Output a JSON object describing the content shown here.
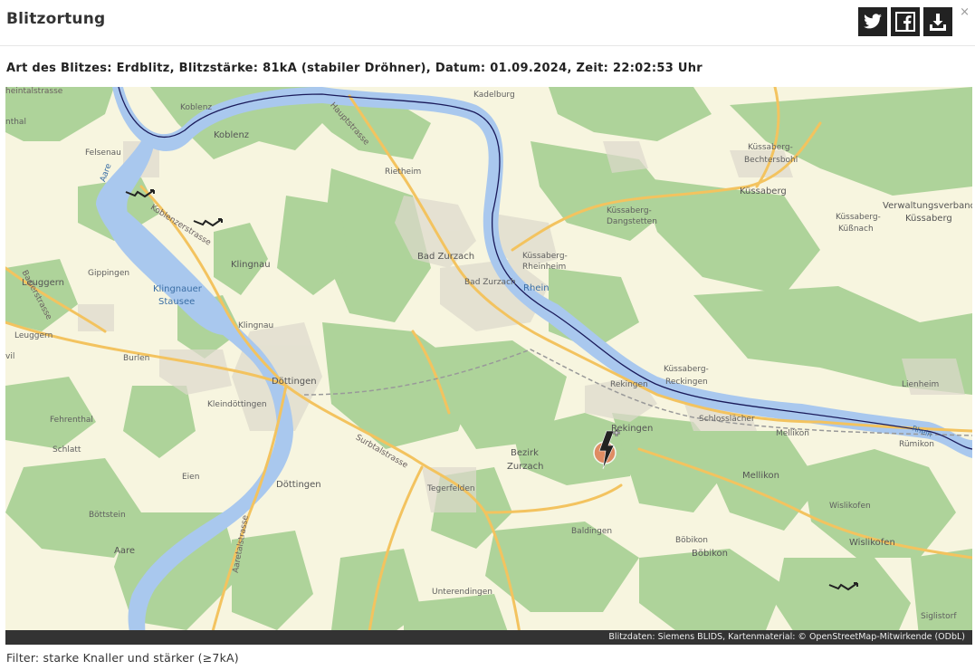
{
  "header": {
    "title": "Blitzortung",
    "share_twitter_icon": "twitter-icon",
    "share_facebook_icon": "facebook-icon",
    "download_icon": "download-icon",
    "close_label": "×"
  },
  "info": {
    "text": "Art des Blitzes: Erdblitz, Blitzstärke: 81kA (stabiler Dröhner), Datum: 01.09.2024, Zeit: 22:02:53 Uhr"
  },
  "map": {
    "labels": {
      "koblenz_top": "Koblenz",
      "koblenz": "Koblenz",
      "felsenau": "Felsenau",
      "aare_top": "Aare",
      "thal": "nthal",
      "heinstrasse": "heintalstrasse",
      "hauptstrasse": "Hauptstrasse",
      "kadelburg": "Kadelburg",
      "kuessaberg_top": "Küssaberg",
      "rietheim": "Rietheim",
      "koblenzerstrasse": "Koblenzerstrasse",
      "klingnau": "Klingnau",
      "gippingen": "Gippingen",
      "leuggern": "Leuggern",
      "leuggern2": "Leuggern",
      "baslerstrasse": "Baslerstrasse",
      "klingnauer": "Klingnauer",
      "stausee": "Stausee",
      "klingnau2": "Klingnau",
      "bad_zurzach": "Bad Zurzach",
      "bad_zurzach2": "Bad Zurzach",
      "rhein": "Rhein",
      "kuessaberg_rheinheim1": "Küssaberg-",
      "kuessaberg_rheinheim2": "Rheinheim",
      "kuessaberg_dang1": "Küssaberg-",
      "kuessaberg_dang2": "Dangstetten",
      "kuessaberg_bech1": "Küssaberg-",
      "kuessaberg_bech2": "Bechtersbohl",
      "kuessaberg": "Küssaberg",
      "verwaltungsverband1": "Verwaltungsverband",
      "verwaltungsverband2": "Küssaberg",
      "kuessaberg_kuess1": "Küssaberg-",
      "kuessaberg_kuess2": "Küßnach",
      "burlen": "Burlen",
      "doettingen": "Döttingen",
      "kleindoettingen": "Kleindöttingen",
      "fehrenthal": "Fehrenthal",
      "schlatt": "Schlatt",
      "vil": "vil",
      "rekingen_small": "Rekingen",
      "kuessaberg_rek1": "Küssaberg-",
      "kuessaberg_rek2": "Reckingen",
      "lienheim": "Lienheim",
      "schlosslaecher": "Schlosslächer",
      "rekingen": "Rekingen",
      "mellikon_small": "Mellikon",
      "ruemikon": "Rümikon",
      "rhein2": "Rhein",
      "surbtalstrasse": "Surbtalstrasse",
      "bezirk": "Bezirk",
      "zurzach": "Zurzach",
      "mellikon": "Mellikon",
      "eien": "Eien",
      "doettingen2": "Döttingen",
      "tegerfelden": "Tegerfelden",
      "wislikofen_small": "Wislikofen",
      "boettstein": "Böttstein",
      "aarestrasse": "Aaretalstrasse",
      "baldingen": "Baldingen",
      "bobikon_small": "Böbikon",
      "bobikon": "Böbikon",
      "wislikofen": "Wislikofen",
      "aare": "Aare",
      "unterendingen": "Unterendingen",
      "siglistorf": "Siglistorf"
    },
    "strike_marker_icon": "lightning-strike-marker-icon",
    "small_bolt_icon": "small-lightning-icon",
    "colors": {
      "water": "#a9c8ee",
      "forest": "#aed39a",
      "land": "#f7f5df",
      "road_major": "#f3c35f",
      "border": "#1a1a5a",
      "marker_circle": "#e8805a"
    },
    "attribution": "Blitzdaten: Siemens BLIDS, Kartenmaterial: © OpenStreetMap-Mitwirkende (ODbL)"
  },
  "filter": {
    "text": "Filter: starke Knaller und stärker (≥7kA)"
  }
}
